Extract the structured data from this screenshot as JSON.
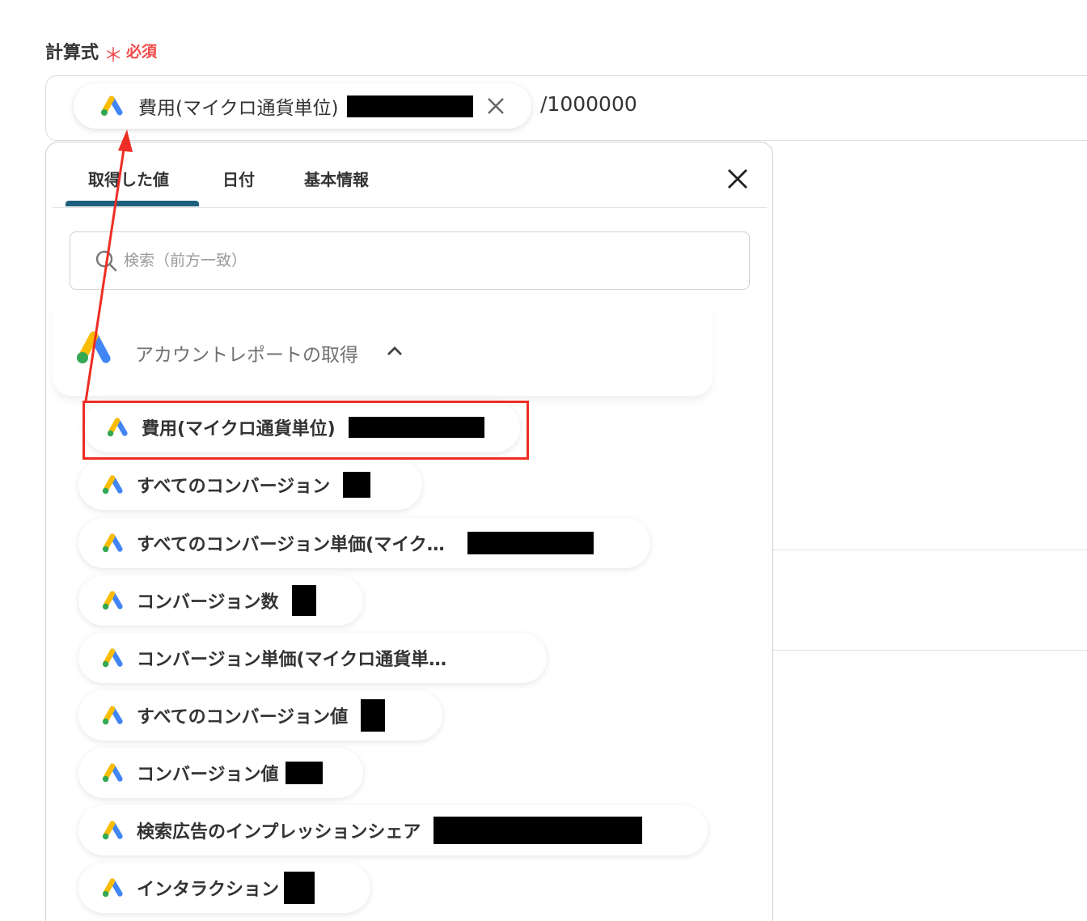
{
  "field": {
    "label": "計算式",
    "required_mark": "＊",
    "required_text": "必須"
  },
  "formula": {
    "chip_label": "費用(マイクロ通貨単位)",
    "suffix_text": "/1000000"
  },
  "panel": {
    "tabs": [
      "取得した値",
      "日付",
      "基本情報"
    ],
    "active_tab": "取得した値",
    "search_placeholder": "検索（前方一致）",
    "group_title": "アカウントレポートの取得",
    "items": [
      {
        "label": "費用(マイクロ通貨単位)",
        "highlighted": true
      },
      {
        "label": "すべてのコンバージョン"
      },
      {
        "label": "すべてのコンバージョン単価(マイク…"
      },
      {
        "label": "コンバージョン数"
      },
      {
        "label": "コンバージョン単価(マイクロ通貨単…"
      },
      {
        "label": "すべてのコンバージョン値"
      },
      {
        "label": "コンバージョン値"
      },
      {
        "label": "検索広告のインプレッションシェア"
      },
      {
        "label": "インタラクション"
      }
    ]
  },
  "colors": {
    "required": "#f04a4a",
    "tab_underline": "#1d5f7d",
    "highlight_box": "#ee2d24",
    "ads_blue": "#4285f4",
    "ads_yellow": "#fbbc04",
    "ads_green": "#34a853"
  },
  "icons": {
    "item_icon": "google-ads-icon",
    "chip_remove": "close-icon",
    "panel_close": "close-icon",
    "search": "search-icon",
    "group_toggle": "chevron-up-icon"
  }
}
